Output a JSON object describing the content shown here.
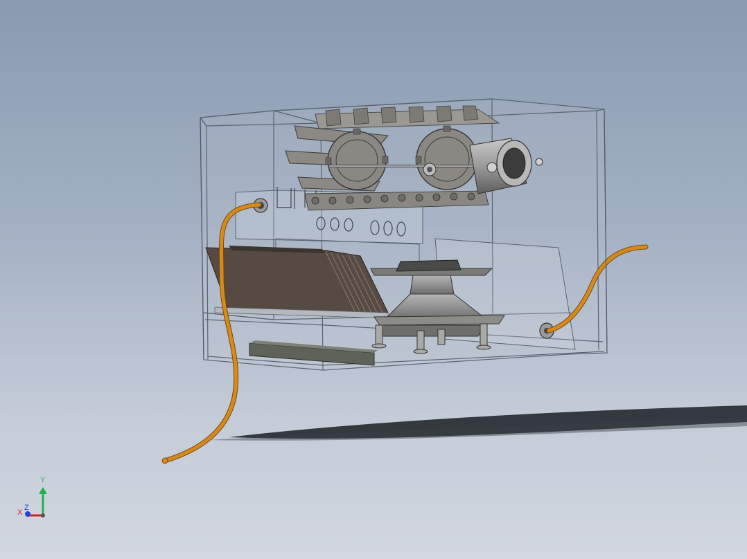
{
  "viewport": {
    "background_top": "#8a9ab0",
    "background_bottom": "#d2d7e0"
  },
  "model": {
    "housing_edge_color": "#5a6370",
    "hose_color": "#d68a1c",
    "metal_color": "#8f8f8f",
    "stack_color": "#574a42",
    "rail_color": "#5f6259"
  },
  "triad": {
    "x_label": "X",
    "y_label": "Y",
    "z_label": "Z",
    "x_color": "#d81b1b",
    "y_color": "#22b14c",
    "z_color": "#2244d8"
  }
}
